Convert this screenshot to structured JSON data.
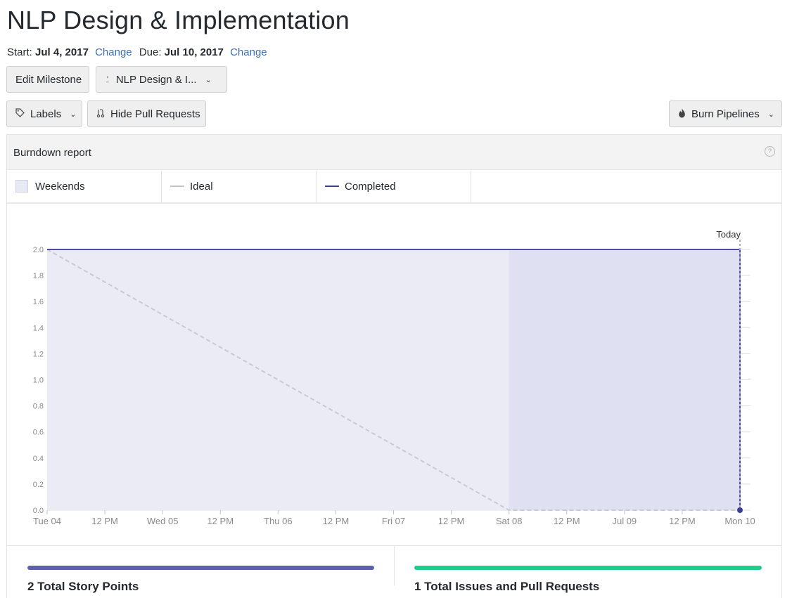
{
  "milestone": {
    "title": "NLP Design & Implementation",
    "start_label": "Start:",
    "start_date": "Jul 4, 2017",
    "due_label": "Due:",
    "due_date": "Jul 10, 2017",
    "change_label": "Change"
  },
  "toolbar": {
    "edit_label": "Edit Milestone",
    "milestone_select_label": "NLP Design & I...",
    "labels_label": "Labels",
    "hide_prs_label": "Hide Pull Requests",
    "burn_label": "Burn Pipelines"
  },
  "report": {
    "title": "Burndown report",
    "legend": [
      "Weekends",
      "Ideal",
      "Completed"
    ],
    "today_label": "Today"
  },
  "colors": {
    "completed": "#4c4fa6",
    "ideal": "#c9c9d4",
    "weekend": "#dfe0f1",
    "area": "#ebebf6",
    "progress_story": "#5f61ad",
    "progress_issues": "#1fcc8c"
  },
  "chart_data": {
    "type": "line",
    "title": "Burndown report",
    "x_ticks": [
      "Tue 04",
      "12 PM",
      "Wed 05",
      "12 PM",
      "Thu 06",
      "12 PM",
      "Fri 07",
      "12 PM",
      "Sat 08",
      "12 PM",
      "Jul 09",
      "12 PM",
      "Mon 10"
    ],
    "y_ticks": [
      "0.0",
      "0.2",
      "0.4",
      "0.6",
      "0.8",
      "1.0",
      "1.2",
      "1.4",
      "1.6",
      "1.8",
      "2.0"
    ],
    "ylim": [
      0,
      2
    ],
    "xlim": [
      "2017-07-04",
      "2017-07-10"
    ],
    "weekend_range": [
      "2017-07-08",
      "2017-07-10"
    ],
    "grid": true,
    "series": [
      {
        "name": "Ideal",
        "style": "dashed",
        "x": [
          "2017-07-04",
          "2017-07-08",
          "2017-07-10"
        ],
        "y": [
          2.0,
          0.0,
          0.0
        ]
      },
      {
        "name": "Completed",
        "style": "solid",
        "x": [
          "2017-07-04",
          "2017-07-10",
          "2017-07-10"
        ],
        "y": [
          2.0,
          2.0,
          0.0
        ]
      }
    ]
  },
  "stats": {
    "story_points_label": "2 Total Story Points",
    "issues_label": "1 Total Issues and Pull Requests"
  }
}
